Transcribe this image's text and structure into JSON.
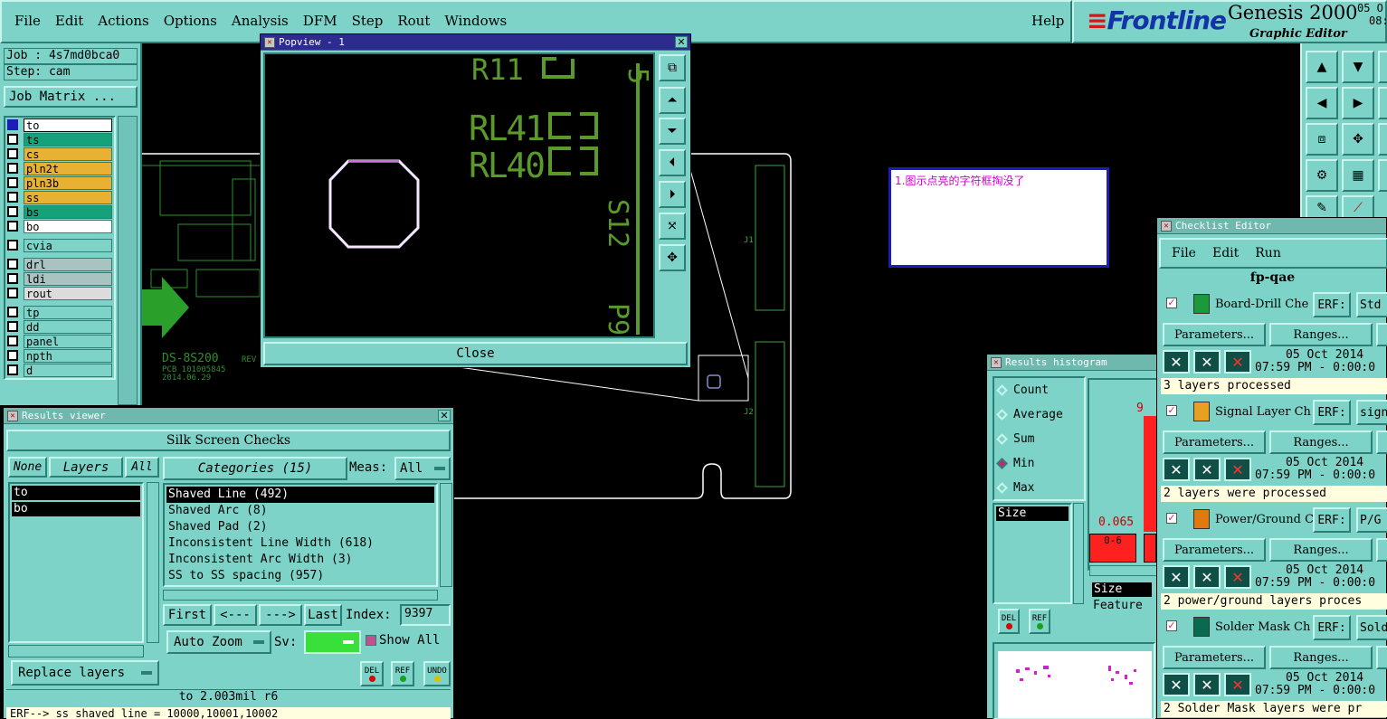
{
  "menubar": {
    "items": [
      "File",
      "Edit",
      "Actions",
      "Options",
      "Analysis",
      "DFM",
      "Step",
      "Rout",
      "Windows"
    ],
    "help": "Help"
  },
  "brand": {
    "logo": "Frontline",
    "product": "Genesis 2000",
    "subtitle": "Graphic Editor",
    "date_frag": "05 O",
    "time_frag": "08:"
  },
  "job": {
    "job_label": "Job : 4s7md0bca0",
    "step_label": "Step: cam",
    "matrix_button": "Job Matrix ..."
  },
  "layers": [
    {
      "name": "to",
      "bg": "#ffffff"
    },
    {
      "name": "ts",
      "bg": "#15a27a"
    },
    {
      "name": "cs",
      "bg": "#e7b233"
    },
    {
      "name": "pln2t",
      "bg": "#e7b233"
    },
    {
      "name": "pln3b",
      "bg": "#e7b233"
    },
    {
      "name": "ss",
      "bg": "#e7b233"
    },
    {
      "name": "bs",
      "bg": "#15a27a"
    },
    {
      "name": "bo",
      "bg": "#ffffff"
    },
    {
      "name": "cvia",
      "bg": "#7ed3c8"
    },
    {
      "name": "drl",
      "bg": "#a9c3c0"
    },
    {
      "name": "ldi",
      "bg": "#a9c3c0"
    },
    {
      "name": "rout",
      "bg": "#dcdcdc"
    },
    {
      "name": "tp",
      "bg": "#7ed3c8"
    },
    {
      "name": "dd",
      "bg": "#7ed3c8"
    },
    {
      "name": "panel",
      "bg": "#7ed3c8"
    },
    {
      "name": "npth",
      "bg": "#7ed3c8"
    },
    {
      "name": "d",
      "bg": "#7ed3c8"
    }
  ],
  "canvas": {
    "board_text1": "DS-8S200",
    "board_text2": "PCB 101005845",
    "board_text3": "2014.06.29",
    "board_rev": "REV"
  },
  "popview": {
    "title": "Popview - 1",
    "labels": {
      "r11": "R11",
      "rl41": "RL41",
      "rl40": "RL40",
      "s12": "S12",
      "p9": "P9",
      "s5": "5"
    },
    "close_button": "Close"
  },
  "note": {
    "text": "1.图示点亮的字符框掏没了",
    "color": "#cc00cc"
  },
  "results_viewer": {
    "title": "Results viewer",
    "header": "Silk Screen Checks",
    "none_button": "None",
    "layers_button": "Layers",
    "all_button": "All",
    "categories_button": "Categories (15)",
    "meas_label": "Meas:",
    "meas_value": "All",
    "layer_list": [
      "to",
      "bo"
    ],
    "categories": [
      "Shaved Line (492)",
      "Shaved Arc (8)",
      "Shaved Pad (2)",
      "Inconsistent Line Width (618)",
      "Inconsistent Arc Width (3)",
      "SS to SS spacing (957)"
    ],
    "first_button": "First",
    "prev_button": "<---",
    "next_button": "--->",
    "last_button": "Last",
    "index_label": "Index:",
    "index_value": "9397",
    "autozoom_button": "Auto Zoom",
    "sv_label": "Sv:",
    "show_all_label": "Show All",
    "replace_button": "Replace layers",
    "del_label": "DEL",
    "ref_label": "REF",
    "undo_label": "UNDO",
    "status_line": "to 2.003mil  r6",
    "erf_line": "ERF--> ss_shaved_line = 10000,10001,10002"
  },
  "histogram": {
    "title": "Results histogram",
    "options": [
      "Count",
      "Average",
      "Sum",
      "Min",
      "Max"
    ],
    "selected_option": "Min",
    "size_label": "Size",
    "value_label": "0.065",
    "bin_label": "0-6",
    "top_tick": "9",
    "size_label2": "Size",
    "feature_label": "Feature",
    "del_label": "DEL",
    "ref_label": "REF"
  },
  "checklist": {
    "title": "Checklist Editor",
    "menu": [
      "File",
      "Edit",
      "Run"
    ],
    "name": "fp-qae",
    "erf_label": "ERF:",
    "params_button": "Parameters...",
    "ranges_button": "Ranges...",
    "items": [
      {
        "name": "Board-Drill Che",
        "erf_value": "Std",
        "date": "05 Oct 2014",
        "time": "07:59 PM - 0:00:0",
        "status": "3 layers processed",
        "icon_color": "#1a9a3a"
      },
      {
        "name": "Signal Layer Ch",
        "erf_value": "sign",
        "date": "05 Oct 2014",
        "time": "07:59 PM - 0:00:0",
        "status": "2 layers were processed",
        "icon_color": "#e8a020"
      },
      {
        "name": "Power/Ground C",
        "erf_value": "P/G",
        "date": "05 Oct 2014",
        "time": "07:59 PM - 0:00:0",
        "status": "2 power/ground layers proces",
        "icon_color": "#e07a10"
      },
      {
        "name": "Solder Mask Ch",
        "erf_value": "Sold",
        "date": "05 Oct 2014",
        "time": "07:59 PM - 0:00:0",
        "status": "2 Solder Mask layers were pr",
        "icon_color": "#0a6a50"
      }
    ]
  }
}
